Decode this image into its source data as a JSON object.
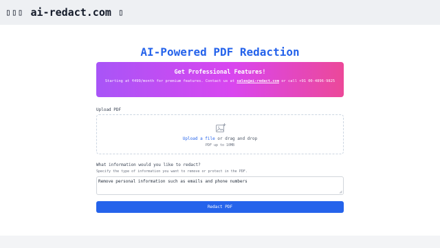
{
  "browser": {
    "leading_glyphs": "▯▯▯",
    "domain": "ai-redact.com",
    "trailing_glyph": "▯"
  },
  "header": {
    "title": "AI-Powered PDF Redaction"
  },
  "promo": {
    "heading": "Get Professional Features!",
    "text_before": "Starting at ₹499/month for premium features. Contact us at ",
    "email": "sales@ai-redact.com",
    "text_after": " or call +91 00-4896-9825"
  },
  "upload": {
    "label": "Upload PDF",
    "link_text": "Upload a file",
    "drag_text": " or drag and drop",
    "limit_text": "PDF up to 10MB",
    "icon": "image-upload-icon"
  },
  "redact_info": {
    "label": "What information would you like to redact?",
    "hint": "Specify the type of information you want to remove or protect in the PDF.",
    "value": "Remove personal information such as emails and phone numbers"
  },
  "actions": {
    "submit_label": "Redact PDF"
  },
  "colors": {
    "accent": "#2563eb",
    "gradient_start": "#a855f7",
    "gradient_end": "#ec4899"
  }
}
